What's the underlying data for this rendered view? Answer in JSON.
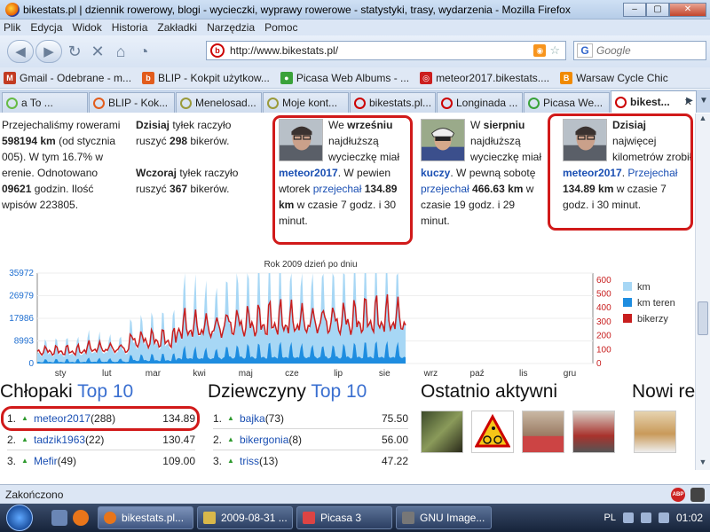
{
  "window": {
    "title": "bikestats.pl | dziennik rowerowy, blogi - wycieczki, wyprawy rowerowe - statystyki, trasy, wydarzenia - Mozilla Firefox",
    "min": "–",
    "max": "▢",
    "close": "✕"
  },
  "menu": [
    "Plik",
    "Edycja",
    "Widok",
    "Historia",
    "Zakładki",
    "Narzędzia",
    "Pomoc"
  ],
  "nav": {
    "url": "http://www.bikestats.pl/",
    "search_placeholder": "Google",
    "search_engine": "G"
  },
  "bookmarks": [
    {
      "label": "Gmail - Odebrane - m...",
      "color": "#c23b22",
      "glyph": "M"
    },
    {
      "label": "BLIP - Kokpit użytkow...",
      "color": "#e25c1c",
      "glyph": "b"
    },
    {
      "label": "Picasa Web Albums - ...",
      "color": "#3aa23a",
      "glyph": "●"
    },
    {
      "label": "meteor2017.bikestats....",
      "color": "#cc1f1f",
      "glyph": "◎"
    },
    {
      "label": "Warsaw Cycle Chic",
      "color": "#f08a00",
      "glyph": "B"
    }
  ],
  "tabs": [
    {
      "label": "a To ...",
      "color": "#6b4"
    },
    {
      "label": "BLIP - Kok...",
      "color": "#e25c1c"
    },
    {
      "label": "Menelosad...",
      "color": "#9a9a3a"
    },
    {
      "label": "Moje kont...",
      "color": "#9a9a3a"
    },
    {
      "label": "bikestats.pl...",
      "color": "#cc1f1f"
    },
    {
      "label": "Longinada ...",
      "color": "#cc1f1f"
    },
    {
      "label": "Picasa We...",
      "color": "#3aa23a"
    },
    {
      "label": "bikest...",
      "color": "#cc1f1f",
      "active": true
    }
  ],
  "stats": {
    "line1": "Przejechaliśmy rowerami",
    "line2_bold": "598194 km",
    "line2_rest": "(od stycznia",
    "line3": "005). W tym 16.7% w",
    "line4": "erenie. Odnotowano",
    "line5_bold": "09621",
    "line5_rest": " godzin. Ilość",
    "line6": "wpisów 223805."
  },
  "activity": {
    "today_bold": "Dzisiaj",
    "today_rest": " tyłek raczyło",
    "today_line2_a": "ruszyć ",
    "today_count": "298",
    "today_line2_b": " bikerów.",
    "yesterday_bold": "Wczoraj",
    "yesterday_rest": " tyłek raczyło",
    "yesterday_line2_a": "ruszyć ",
    "yesterday_count": "367",
    "yesterday_line2_b": " bikerów."
  },
  "card1": {
    "a": "We ",
    "month": "wrześniu",
    "b": "najdłuższą",
    "c": "wycieczkę miał",
    "user": "meteor2017",
    "d": ". W pewien",
    "e": "wtorek ",
    "action": "przejechał",
    "km": " 134.89",
    "km_unit": "km",
    "f": " w czasie 7 godz. i 30",
    "g": "minut."
  },
  "card2": {
    "a": "W ",
    "month": "sierpniu",
    "b": "najdłuższą",
    "c": "wycieczkę miał",
    "user": "kuczy",
    "d": ". W pewną sobotę",
    "action": "przejechał",
    "km": " 466.63 km",
    "e": " w",
    "f": "czasie 19 godz. i 29",
    "g": "minut."
  },
  "card3": {
    "today": "Dzisiaj",
    "a": "najwięcej",
    "b": "kilometrów",
    "c": "zrobił ",
    "user": "meteor2017",
    "d": ".",
    "action": "Przejechał",
    "km": " 134.89 km",
    "e": " w",
    "f": "czasie 7 godz. i 30 minut."
  },
  "chart_data": {
    "type": "area",
    "title": "Rok 2009 dzień po dniu",
    "x_ticks": [
      "sty",
      "lut",
      "mar",
      "kwi",
      "maj",
      "cze",
      "lip",
      "sie",
      "wrz",
      "paź",
      "lis",
      "gru"
    ],
    "y_left_ticks": [
      "0",
      "8993",
      "17986",
      "26979",
      "35972"
    ],
    "y_left_range": [
      0,
      35972
    ],
    "y_right_ticks": [
      "0",
      "100",
      "200",
      "300",
      "400",
      "500",
      "600"
    ],
    "y_right_range": [
      0,
      650
    ],
    "days_shown": 243,
    "legend_position": "right",
    "series": [
      {
        "name": "km",
        "color": "#a7d7f5",
        "axis": "left",
        "monthly_avg": [
          5200,
          6500,
          10500,
          17500,
          20000,
          20500,
          21500,
          22500,
          21000
        ]
      },
      {
        "name": "km teren",
        "color": "#1e8de0",
        "axis": "left",
        "monthly_avg": [
          900,
          1100,
          1900,
          3200,
          3800,
          3900,
          3900,
          4000,
          3600
        ]
      },
      {
        "name": "bikerzy",
        "color": "#c81e1e",
        "axis": "right",
        "monthly_avg": [
          90,
          110,
          170,
          260,
          290,
          300,
          310,
          320,
          290
        ]
      }
    ]
  },
  "top_men": {
    "title_a": "Chłopaki ",
    "title_b": "Top 10",
    "rows": [
      {
        "num": "1.",
        "name": "meteor2017",
        "count": "(288)",
        "value": "134.89"
      },
      {
        "num": "2.",
        "name": "tadzik1963",
        "count": "(22)",
        "value": "130.47"
      },
      {
        "num": "3.",
        "name": "Mefir",
        "count": "(49)",
        "value": "109.00"
      }
    ]
  },
  "top_women": {
    "title_a": "Dziewczyny ",
    "title_b": "Top 10",
    "rows": [
      {
        "num": "1.",
        "name": "bajka",
        "count": "(73)",
        "value": "75.50"
      },
      {
        "num": "2.",
        "name": "bikergonia",
        "count": "(8)",
        "value": "56.00"
      },
      {
        "num": "3.",
        "name": "triss",
        "count": "(13)",
        "value": "47.22"
      }
    ]
  },
  "recent": {
    "title": "Ostatnio aktywni"
  },
  "new_users": {
    "title": "Nowi re"
  },
  "status": {
    "text": "Zakończono",
    "abp": "ABP"
  },
  "taskbar": {
    "tasks": [
      {
        "label": "bikestats.pl...",
        "color": "#e8751a",
        "active": true
      },
      {
        "label": "2009-08-31 ...",
        "color": "#d9b84a"
      },
      {
        "label": "Picasa 3",
        "color": "#d44"
      },
      {
        "label": "GNU Image...",
        "color": "#777"
      }
    ],
    "lang": "PL",
    "time": "01:02"
  }
}
